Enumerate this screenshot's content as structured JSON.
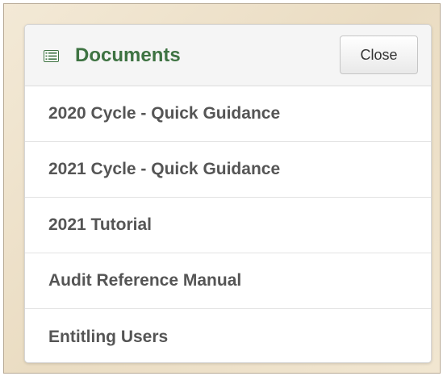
{
  "panel": {
    "title": "Documents",
    "close_label": "Close",
    "icon": "list-icon",
    "title_color": "#3e7342"
  },
  "documents": [
    {
      "label": "2020 Cycle - Quick Guidance"
    },
    {
      "label": "2021 Cycle - Quick Guidance"
    },
    {
      "label": "2021 Tutorial"
    },
    {
      "label": "Audit Reference Manual"
    },
    {
      "label": "Entitling Users"
    }
  ]
}
